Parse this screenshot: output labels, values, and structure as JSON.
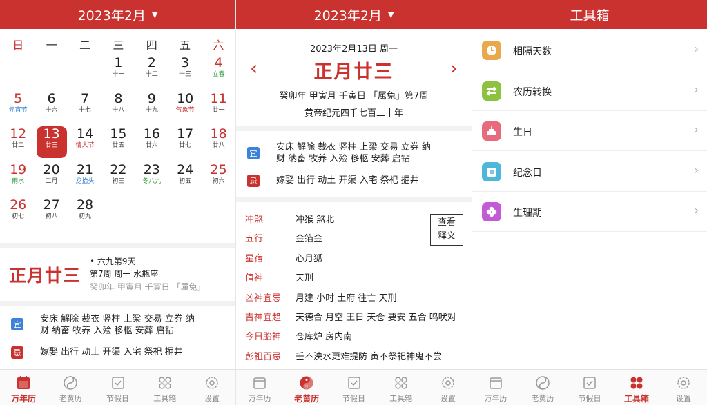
{
  "panel1": {
    "header_title": "2023年2月",
    "weekdays": [
      "日",
      "一",
      "二",
      "三",
      "四",
      "五",
      "六"
    ],
    "days": [
      {
        "n": "1",
        "l": "十一"
      },
      {
        "n": "2",
        "l": "十二"
      },
      {
        "n": "3",
        "l": "十三"
      },
      {
        "n": "4",
        "l": "立春"
      },
      {
        "n": "5",
        "l": "元宵节"
      },
      {
        "n": "6",
        "l": "十六"
      },
      {
        "n": "7",
        "l": "十七"
      },
      {
        "n": "8",
        "l": "十八"
      },
      {
        "n": "9",
        "l": "十九"
      },
      {
        "n": "10",
        "l": "气象节"
      },
      {
        "n": "11",
        "l": "廿一"
      },
      {
        "n": "12",
        "l": "廿二"
      },
      {
        "n": "13",
        "l": "廿三"
      },
      {
        "n": "14",
        "l": "情人节"
      },
      {
        "n": "15",
        "l": "廿五"
      },
      {
        "n": "16",
        "l": "廿六"
      },
      {
        "n": "17",
        "l": "廿七"
      },
      {
        "n": "18",
        "l": "廿八"
      },
      {
        "n": "19",
        "l": "雨水"
      },
      {
        "n": "20",
        "l": "二月"
      },
      {
        "n": "21",
        "l": "龙抬头"
      },
      {
        "n": "22",
        "l": "初三"
      },
      {
        "n": "23",
        "l": "冬八九"
      },
      {
        "n": "24",
        "l": "初五"
      },
      {
        "n": "25",
        "l": "初六"
      },
      {
        "n": "26",
        "l": "初七"
      },
      {
        "n": "27",
        "l": "初八"
      },
      {
        "n": "28",
        "l": "初九"
      }
    ],
    "big_lunar": "正月廿三",
    "info_line1": "• 六九第9天",
    "info_line2": "第7周 周一   水瓶座",
    "info_line3": "癸卯年   甲寅月   壬寅日   「属兔」",
    "yi_label": "宜",
    "yi_text_1": "安床 解除 裁衣 竖柱 上梁 交易 立券 纳",
    "yi_text_2": "财 纳畜 牧养 入殓 移柩 安葬 启钻",
    "ji_label": "忌",
    "ji_text": "嫁娶 出行 动土 开渠 入宅 祭祀 掘井"
  },
  "panel2": {
    "header_title": "2023年2月",
    "date_line": "2023年2月13日   周一",
    "lunar": "正月廿三",
    "prev_arrow": "‹",
    "next_arrow": "›",
    "ganzhi_line": "癸卯年   甲寅月   壬寅日    「属兔」第7周",
    "huangdi_line": "黄帝纪元四千七百二十年",
    "yi_label": "宜",
    "yi_text_1": "安床 解除 裁衣 竖柱 上梁 交易 立券 纳",
    "yi_text_2": "财 纳畜 牧养 入殓 移柩 安葬 启钻",
    "ji_label": "忌",
    "ji_text": "嫁娶 出行 动土 开渠 入宅 祭祀 掘井",
    "details": [
      {
        "k": "冲煞",
        "v": "冲猴 煞北"
      },
      {
        "k": "五行",
        "v": "金箔金"
      },
      {
        "k": "星宿",
        "v": "心月狐"
      },
      {
        "k": "值神",
        "v": "天刑"
      },
      {
        "k": "凶神宜忌",
        "v": "月建 小时 土府 往亡 天刑"
      },
      {
        "k": "吉神宜趋",
        "v": "天德合 月空 王日 天仓 要安 五合 鸣吠对"
      },
      {
        "k": "今日胎神",
        "v": "仓库炉 房内南"
      },
      {
        "k": "彭祖百忌",
        "v": "壬不泱水更难提防 寅不祭祀神鬼不尝"
      }
    ],
    "detail_button_1": "查看",
    "detail_button_2": "释义"
  },
  "panel3": {
    "header_title": "工具箱",
    "tools": [
      {
        "label": "相隔天数",
        "color": "#e9a94a"
      },
      {
        "label": "农历转换",
        "color": "#8cc23f"
      },
      {
        "label": "生日",
        "color": "#e86b7d"
      },
      {
        "label": "纪念日",
        "color": "#4fb7d9"
      },
      {
        "label": "生理期",
        "color": "#c35bd6"
      }
    ]
  },
  "tabs": [
    "万年历",
    "老黄历",
    "节假日",
    "工具箱",
    "设置"
  ],
  "colors": {
    "accent": "#c9322f",
    "inactive": "#888888"
  }
}
